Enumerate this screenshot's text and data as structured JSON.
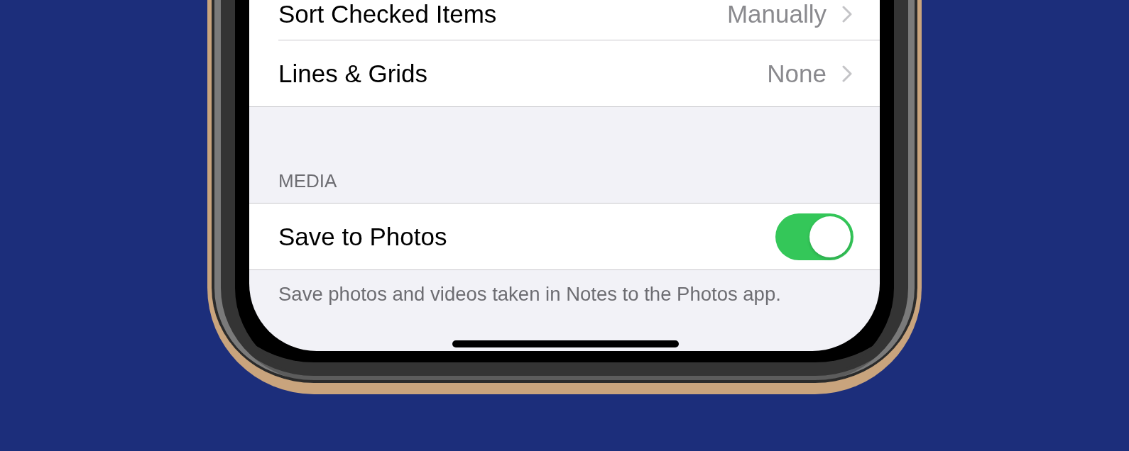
{
  "screen": {
    "groups": [
      {
        "rows": [
          {
            "kind": "disclosure",
            "label": "Sort Checked Items",
            "value": "Manually"
          },
          {
            "kind": "disclosure",
            "label": "Lines & Grids",
            "value": "None"
          }
        ]
      },
      {
        "header": "MEDIA",
        "rows": [
          {
            "kind": "toggle",
            "label": "Save to Photos",
            "on": true
          }
        ],
        "footer": "Save photos and videos taken in Notes to the Photos app."
      }
    ]
  }
}
